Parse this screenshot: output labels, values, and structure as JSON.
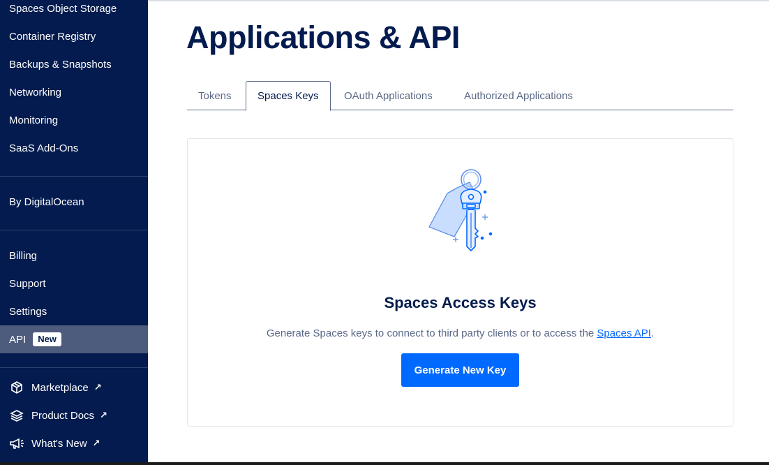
{
  "sidebar": {
    "top_items": [
      {
        "label": "Spaces Object Storage"
      },
      {
        "label": "Container Registry"
      },
      {
        "label": "Backups & Snapshots"
      },
      {
        "label": "Networking"
      },
      {
        "label": "Monitoring"
      },
      {
        "label": "SaaS Add-Ons"
      }
    ],
    "by_digitalocean": "By DigitalOcean",
    "account_items": [
      {
        "label": "Billing"
      },
      {
        "label": "Support"
      },
      {
        "label": "Settings"
      }
    ],
    "api": {
      "label": "API",
      "badge": "New"
    },
    "external_links": [
      {
        "label": "Marketplace",
        "icon": "cube-icon"
      },
      {
        "label": "Product Docs",
        "icon": "layers-icon"
      },
      {
        "label": "What's New",
        "icon": "megaphone-icon"
      }
    ],
    "external_glyph": "↗"
  },
  "main": {
    "title": "Applications & API",
    "tabs": [
      {
        "label": "Tokens",
        "active": false
      },
      {
        "label": "Spaces Keys",
        "active": true
      },
      {
        "label": "OAuth Applications",
        "active": false
      },
      {
        "label": "Authorized Applications",
        "active": false
      }
    ],
    "card": {
      "illustration": "key-icon",
      "title": "Spaces Access Keys",
      "desc_prefix": "Generate Spaces keys to connect to third party clients or to access the ",
      "desc_link": "Spaces API",
      "desc_suffix": ".",
      "button": "Generate New Key"
    }
  },
  "colors": {
    "sidebar_bg": "#031b4e",
    "active_bg": "#4d5b7c",
    "primary": "#0069ff",
    "heading": "#031b4e",
    "muted": "#5b6987"
  }
}
